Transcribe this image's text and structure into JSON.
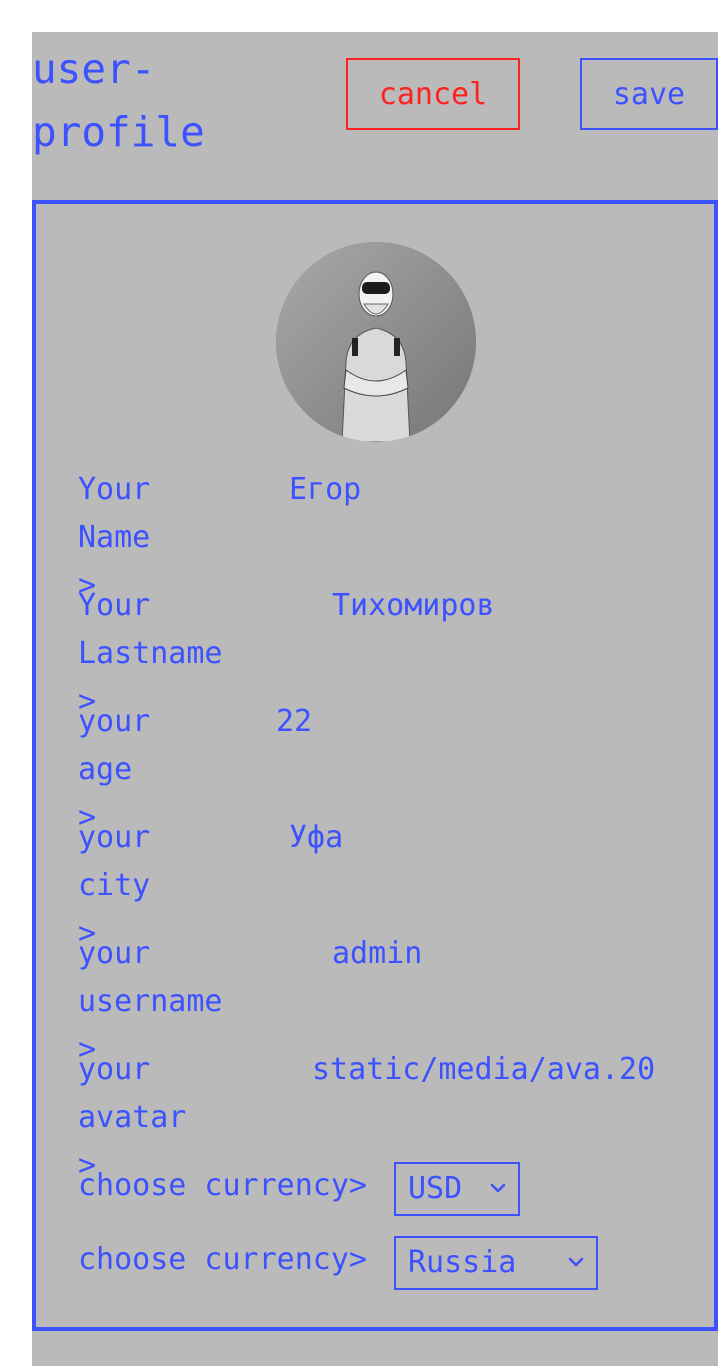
{
  "header": {
    "title": "user-\nprofile",
    "cancel_label": "cancel",
    "save_label": "save"
  },
  "profile": {
    "avatar_icon": "user-avatar-photo",
    "fields": [
      {
        "label": "Your Name\n>",
        "value": "Егор"
      },
      {
        "label": "Your\nLastname >",
        "value": "Тихомиров"
      },
      {
        "label": "your age\n>",
        "value": "22"
      },
      {
        "label": "your city\n>",
        "value": "Уфа"
      },
      {
        "label": "your\nusername >",
        "value": "admin"
      },
      {
        "label": "your avatar\n>",
        "value": "static/media/ava.20"
      }
    ],
    "currency": {
      "label": "choose currency>",
      "selected": "USD"
    },
    "country": {
      "label": "choose currency>",
      "selected": "Russia"
    }
  },
  "colors": {
    "accent": "#3c52ff",
    "danger": "#ff2020",
    "background": "#bbbabb"
  }
}
